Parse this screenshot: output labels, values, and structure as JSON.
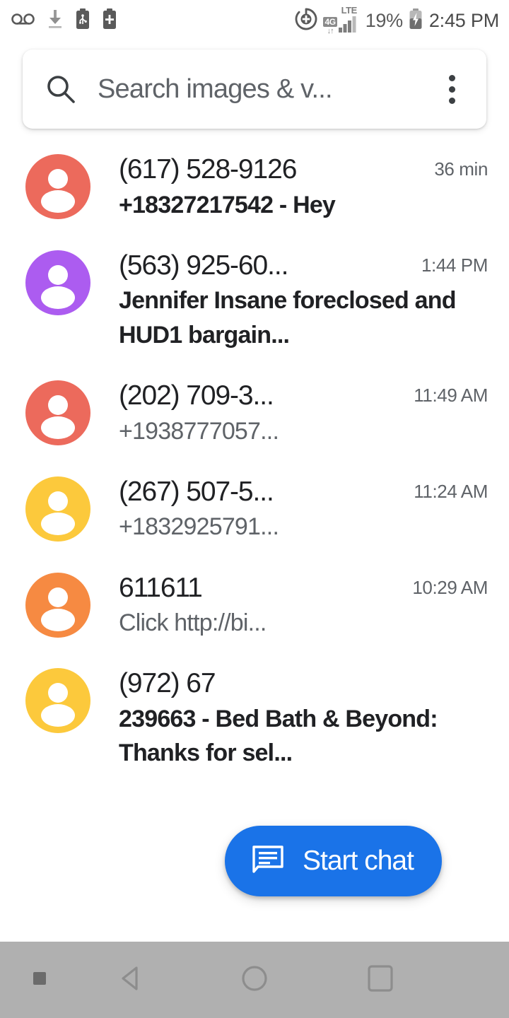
{
  "status_bar": {
    "icons_left": [
      "voicemail-icon",
      "download-icon",
      "usb-battery-icon",
      "battery-plus-icon"
    ],
    "data_saver_icon": "data-saver-icon",
    "network_badge": "4G",
    "network_arrows": "↓↑",
    "network_type": "LTE",
    "signal_icon": "signal-bars-icon",
    "battery_percent": "19%",
    "battery_icon": "battery-charging-icon",
    "clock": "2:45 PM"
  },
  "search": {
    "icon": "search-icon",
    "placeholder": "Search images & v...",
    "overflow_icon": "more-vert-icon"
  },
  "conversations": [
    {
      "avatar_color": "#EC6A5C",
      "avatar_icon": "person-avatar-icon",
      "title": "(617) 528-9126",
      "time": "36 min",
      "preview": "+18327217542 - Hey",
      "unread": true
    },
    {
      "avatar_color": "#AC5CF0",
      "avatar_icon": "person-avatar-icon",
      "title": "(563) 925-60...",
      "time": "1:44 PM",
      "preview": "Jennifer Insane foreclosed and HUD1 bargain...",
      "unread": true
    },
    {
      "avatar_color": "#EC6A5C",
      "avatar_icon": "person-avatar-icon",
      "title": "(202) 709-3...",
      "time": "11:49 AM",
      "preview": "+1938777057...",
      "unread": false
    },
    {
      "avatar_color": "#FCC93C",
      "avatar_icon": "person-avatar-icon",
      "title": "(267) 507-5...",
      "time": "11:24 AM",
      "preview": "+1832925791...",
      "unread": false
    },
    {
      "avatar_color": "#F68A42",
      "avatar_icon": "person-avatar-icon",
      "title": "611611",
      "time": "10:29 AM",
      "preview": "Click http://bi...",
      "unread": false
    },
    {
      "avatar_color": "#FCC93C",
      "avatar_icon": "person-avatar-icon",
      "title": "(972) 67",
      "time": "",
      "preview": "239663 - Bed Bath & Beyond: Thanks for sel...",
      "unread": true
    }
  ],
  "fab": {
    "icon": "start-chat-icon",
    "label": "Start chat",
    "color": "#1A73E8"
  },
  "nav_bar": {
    "back_icon": "back-triangle-icon",
    "home_icon": "home-circle-icon",
    "recents_icon": "recents-square-icon",
    "indicator_icon": "nav-dot-icon"
  }
}
